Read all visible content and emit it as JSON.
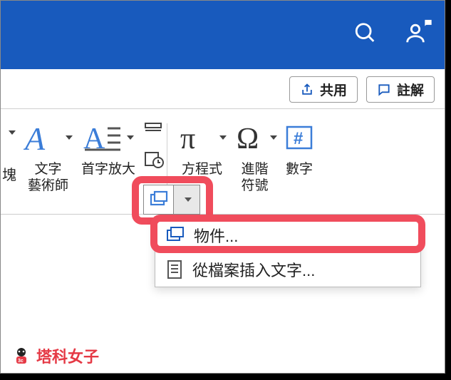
{
  "actions": {
    "share": "共用",
    "comment": "註解"
  },
  "ribbon": {
    "block_partial": "塊",
    "wordart": "文字\n藝術師",
    "dropcap": "首字放大",
    "equation": "方程式",
    "symbol": "進階\n符號",
    "number": "數字"
  },
  "menu": {
    "object": "物件...",
    "insert_text_from_file": "從檔案插入文字..."
  },
  "watermark": "塔科女子"
}
